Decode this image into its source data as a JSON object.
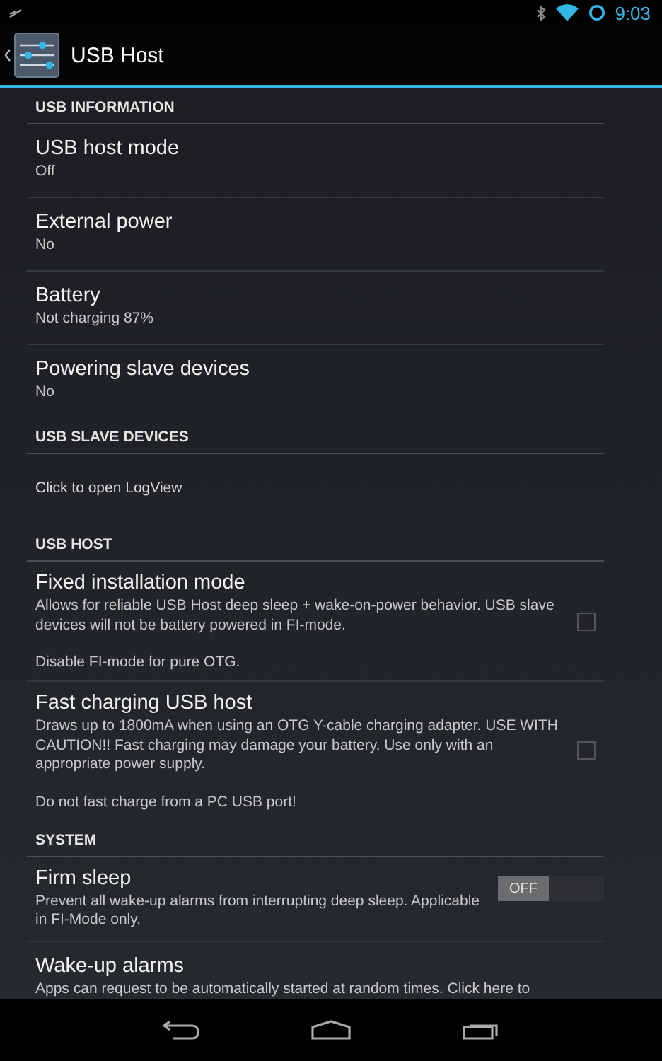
{
  "status_bar": {
    "time": "9:03"
  },
  "action_bar": {
    "title": "USB Host"
  },
  "sections": [
    {
      "title": "USB INFORMATION",
      "items": [
        {
          "kind": "info",
          "title": "USB host mode",
          "summary": "Off"
        },
        {
          "kind": "info",
          "title": "External power",
          "summary": "No"
        },
        {
          "kind": "info",
          "title": "Battery",
          "summary": "Not charging 87%"
        },
        {
          "kind": "info",
          "title": "Powering slave devices",
          "summary": "No"
        }
      ]
    },
    {
      "title": "USB SLAVE DEVICES",
      "items": [
        {
          "kind": "link",
          "summary": "Click to open LogView"
        }
      ]
    },
    {
      "title": "USB HOST",
      "items": [
        {
          "kind": "checkbox",
          "title": "Fixed installation mode",
          "summary": "Allows for reliable USB Host deep sleep + wake-on-power behavior. USB slave devices will not be battery powered in FI-mode.",
          "note": "Disable FI-mode for pure OTG.",
          "checked": false
        },
        {
          "kind": "checkbox",
          "title": "Fast charging USB host",
          "summary": "Draws up to 1800mA when using an OTG Y-cable charging adapter. USE WITH CAUTION!! Fast charging may damage your battery. Use only with an appropriate power supply.",
          "note": "Do not fast charge from a PC USB port!",
          "checked": false
        }
      ]
    },
    {
      "title": "SYSTEM",
      "items": [
        {
          "kind": "switch",
          "title": "Firm sleep",
          "summary": "Prevent all wake-up alarms from interrupting deep sleep. Applicable in FI-Mode only.",
          "on": false,
          "state_label": "OFF"
        },
        {
          "kind": "info",
          "title": "Wake-up alarms",
          "summary": "Apps can request to be automatically started at random times. Click here to"
        }
      ]
    }
  ]
}
